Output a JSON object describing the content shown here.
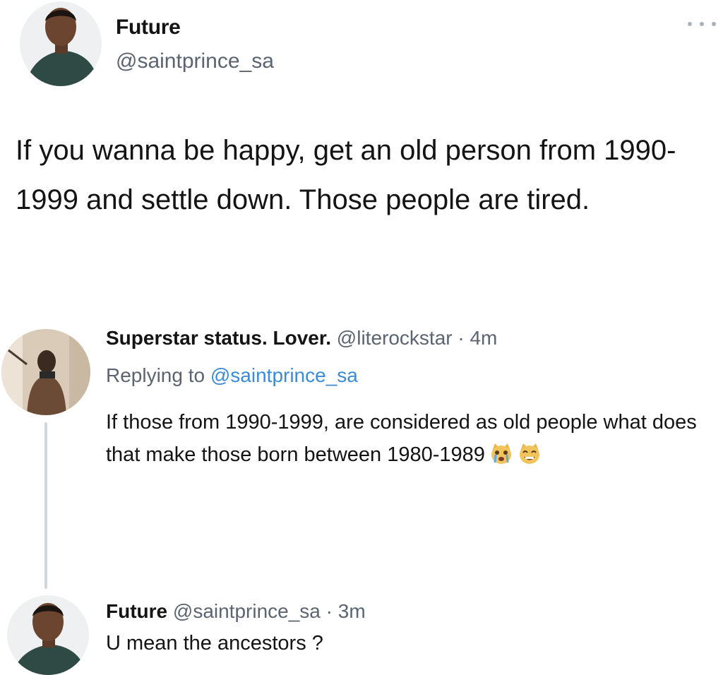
{
  "main_tweet": {
    "display_name": "Future",
    "handle": "@saintprince_sa",
    "text": "If you wanna be happy, get an old person from 1990-1999 and settle down. Those people are tired."
  },
  "reply": {
    "display_name": "Superstar status. Lover.",
    "handle": "@literockstar",
    "separator": "·",
    "time": "4m",
    "replying_prefix": "Replying to",
    "replying_handle": "@saintprince_sa",
    "text": "If those from 1990-1999, are considered as old people what does that make those born between 1980-1989",
    "emojis": [
      "crying-cat-emoji",
      "grinning-cat-emoji"
    ]
  },
  "answer": {
    "display_name": "Future",
    "handle": "@saintprince_sa",
    "separator": "·",
    "time": "3m",
    "text": "U mean the ancestors ?"
  },
  "icons": {
    "more": "more-options-icon"
  },
  "colors": {
    "text": "#141414",
    "muted": "#5b6470",
    "link": "#3b8bd6",
    "thread_line": "#d2d6da"
  }
}
